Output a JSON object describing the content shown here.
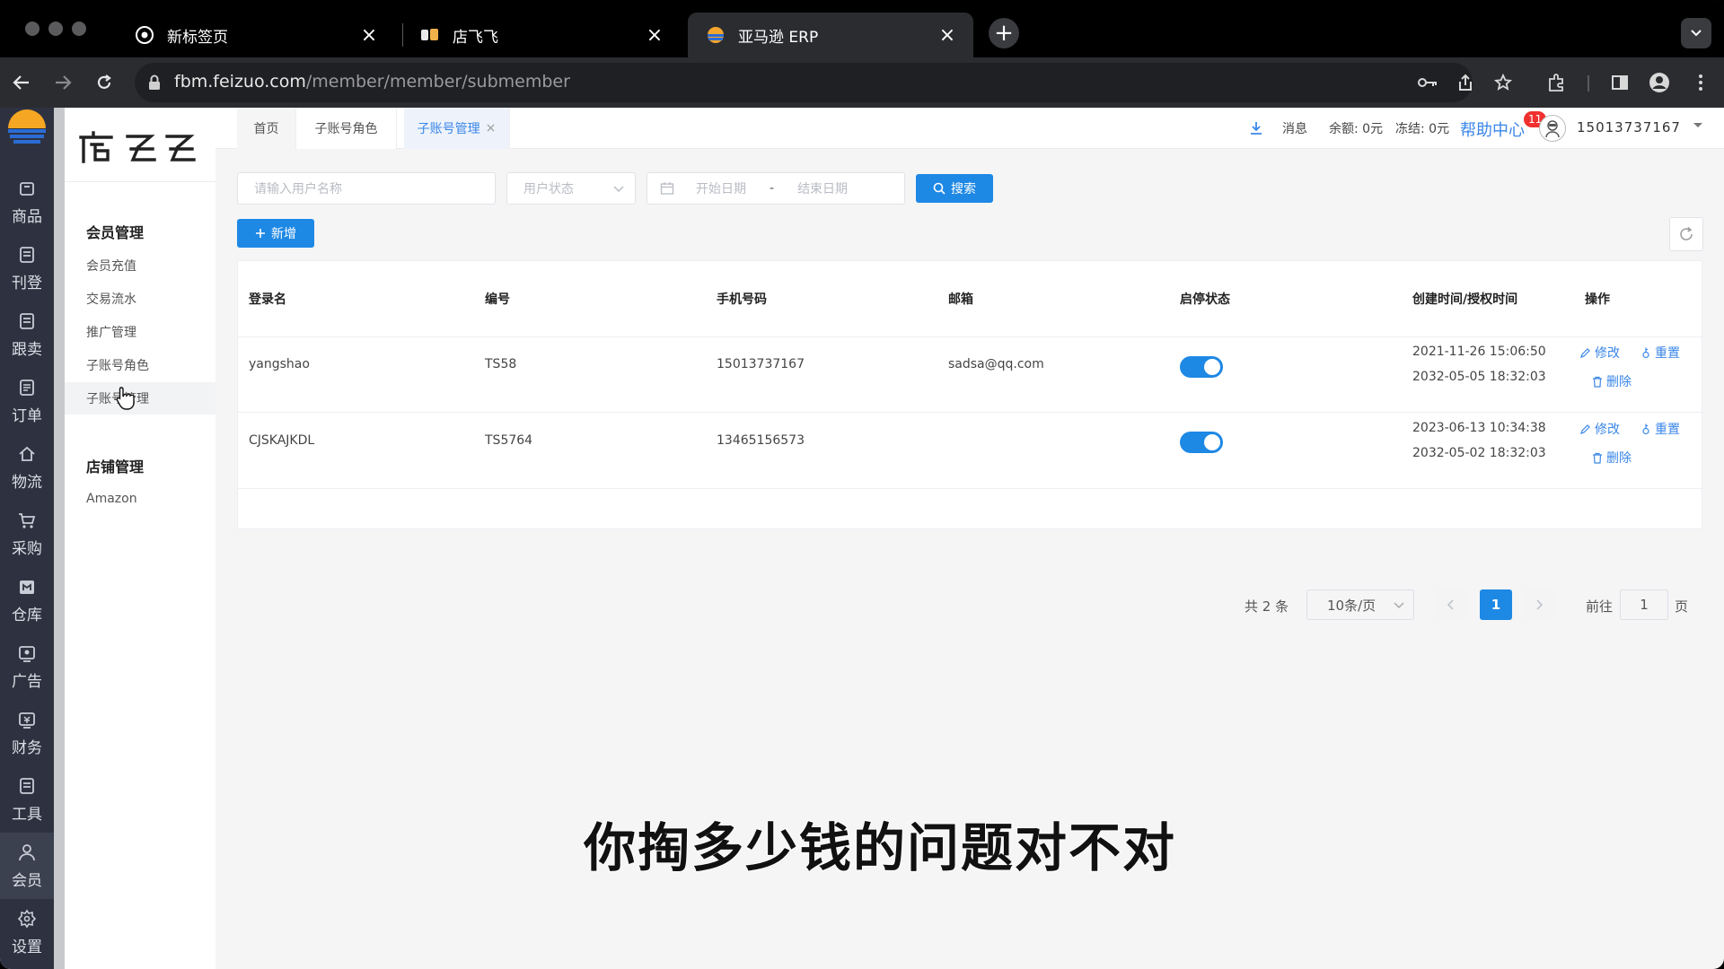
{
  "browser": {
    "tabs": [
      {
        "title": "新标签页",
        "close": "×"
      },
      {
        "title": "店飞飞",
        "close": "×"
      },
      {
        "title": "亚马逊 ERP",
        "close": "×"
      }
    ],
    "new_tab": "+",
    "url_host": "fbm.feizuo.com",
    "url_path": "/member/member/submember"
  },
  "iconbar": {
    "items": [
      {
        "label": "商品",
        "icon": "box-icon"
      },
      {
        "label": "刊登",
        "icon": "doc-icon"
      },
      {
        "label": "跟卖",
        "icon": "doc-icon"
      },
      {
        "label": "订单",
        "icon": "list-icon"
      },
      {
        "label": "物流",
        "icon": "home-icon"
      },
      {
        "label": "采购",
        "icon": "cart-icon"
      },
      {
        "label": "仓库",
        "icon": "warehouse-icon"
      },
      {
        "label": "广告",
        "icon": "ad-icon"
      },
      {
        "label": "财务",
        "icon": "finance-icon"
      },
      {
        "label": "工具",
        "icon": "tool-icon"
      },
      {
        "label": "会员",
        "icon": "user-icon"
      },
      {
        "label": "设置",
        "icon": "gear-icon"
      }
    ]
  },
  "menu": {
    "brand": "店飞飞",
    "group1": "会员管理",
    "group1_items": [
      "会员充值",
      "交易流水",
      "推广管理",
      "子账号角色",
      "子账号管理"
    ],
    "group2": "店铺管理",
    "group2_items": [
      "Amazon"
    ]
  },
  "header": {
    "tabs": [
      "首页",
      "子账号角色",
      "子账号管理"
    ],
    "tab_close": "×",
    "messages_label": "消息",
    "messages_count": "11",
    "balance": "余额: 0元",
    "frozen": "冻结: 0元",
    "help": "帮助中心",
    "user": "15013737167"
  },
  "filters": {
    "username_placeholder": "请输入用户名称",
    "status_placeholder": "用户状态",
    "start_date_placeholder": "开始日期",
    "date_separator": "-",
    "end_date_placeholder": "结束日期",
    "search_label": "搜索",
    "add_label": "新增"
  },
  "table": {
    "columns": [
      "登录名",
      "编号",
      "手机号码",
      "邮箱",
      "启停状态",
      "创建时间/授权时间",
      "操作"
    ],
    "rows": [
      {
        "login": "yangshao",
        "code": "TS58",
        "phone": "15013737167",
        "email": "sadsa@qq.com",
        "enabled": true,
        "created": "2021-11-26 15:06:50",
        "authorized": "2032-05-05 18:32:03"
      },
      {
        "login": "CJSKAJKDL",
        "code": "TS5764",
        "phone": "13465156573",
        "email": "",
        "enabled": true,
        "created": "2023-06-13 10:34:38",
        "authorized": "2032-05-02 18:32:03"
      }
    ],
    "actions": {
      "edit": "修改",
      "reset": "重置",
      "delete": "删除"
    }
  },
  "pagination": {
    "total": "共 2 条",
    "page_size": "10条/页",
    "current": "1",
    "goto_label": "前往",
    "goto_value": "1",
    "page_suffix": "页"
  },
  "subtitle": "你掏多少钱的问题对不对",
  "colors": {
    "accent": "#1e88e5",
    "sidebar": "#2e3240",
    "badge": "#f03030"
  }
}
